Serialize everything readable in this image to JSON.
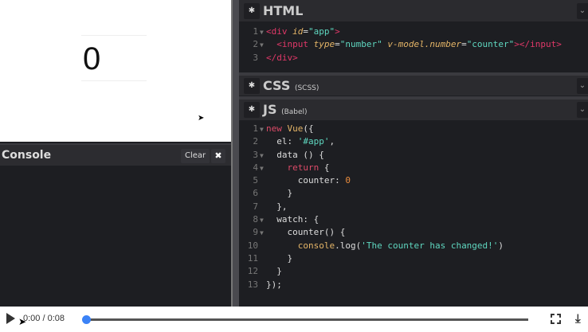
{
  "preview": {
    "counter_value": "0"
  },
  "console": {
    "title": "Console",
    "clear_label": "Clear",
    "close_label": "✖"
  },
  "panels": {
    "html": {
      "title": "HTML",
      "sub": ""
    },
    "css": {
      "title": "CSS",
      "sub": "(SCSS)"
    },
    "js": {
      "title": "JS",
      "sub": "(Babel)"
    }
  },
  "html_code": [
    {
      "n": "1",
      "fold": true,
      "t": [
        [
          "<div ",
          "tag"
        ],
        [
          "id",
          "attr"
        ],
        [
          "=",
          ""
        ],
        [
          "\"app\"",
          "str"
        ],
        [
          ">",
          "tag"
        ]
      ]
    },
    {
      "n": "2",
      "fold": true,
      "t": [
        [
          "  <input ",
          "tag"
        ],
        [
          "type",
          "attr"
        ],
        [
          "=",
          ""
        ],
        [
          "\"number\" ",
          "str"
        ],
        [
          "v-model.number",
          "attr"
        ],
        [
          "=",
          ""
        ],
        [
          "\"counter\"",
          "str"
        ],
        [
          "></input>",
          "tag"
        ]
      ]
    },
    {
      "n": "3",
      "fold": false,
      "t": [
        [
          "</div>",
          "tag"
        ]
      ]
    }
  ],
  "js_code": [
    {
      "n": "1",
      "fold": true,
      "t": [
        [
          "new ",
          "k"
        ],
        [
          "Vue",
          "cls"
        ],
        [
          "({",
          ""
        ]
      ]
    },
    {
      "n": "2",
      "fold": false,
      "t": [
        [
          "  el: ",
          ""
        ],
        [
          "'#app'",
          "str"
        ],
        [
          ",",
          ""
        ]
      ]
    },
    {
      "n": "3",
      "fold": true,
      "t": [
        [
          "  data () {",
          ""
        ]
      ]
    },
    {
      "n": "4",
      "fold": true,
      "t": [
        [
          "    return ",
          "k"
        ],
        [
          "{",
          ""
        ]
      ]
    },
    {
      "n": "5",
      "fold": false,
      "t": [
        [
          "      counter: ",
          ""
        ],
        [
          "0",
          "num"
        ]
      ]
    },
    {
      "n": "6",
      "fold": false,
      "t": [
        [
          "    }",
          ""
        ]
      ]
    },
    {
      "n": "7",
      "fold": false,
      "t": [
        [
          "  },",
          ""
        ]
      ]
    },
    {
      "n": "8",
      "fold": true,
      "t": [
        [
          "  watch: {",
          ""
        ]
      ]
    },
    {
      "n": "9",
      "fold": true,
      "t": [
        [
          "    counter() {",
          ""
        ]
      ]
    },
    {
      "n": "10",
      "fold": false,
      "t": [
        [
          "      ",
          ""
        ],
        [
          "console",
          "fn"
        ],
        [
          ".log(",
          ""
        ],
        [
          "'The counter has changed!'",
          "str"
        ],
        [
          ")",
          ""
        ]
      ]
    },
    {
      "n": "11",
      "fold": false,
      "t": [
        [
          "    }",
          ""
        ]
      ]
    },
    {
      "n": "12",
      "fold": false,
      "t": [
        [
          "  }",
          ""
        ]
      ]
    },
    {
      "n": "13",
      "fold": false,
      "t": [
        [
          "});",
          ""
        ]
      ]
    }
  ],
  "video": {
    "time": "0:00 / 0:08",
    "progress": 0,
    "accent": "#3b82f6"
  }
}
